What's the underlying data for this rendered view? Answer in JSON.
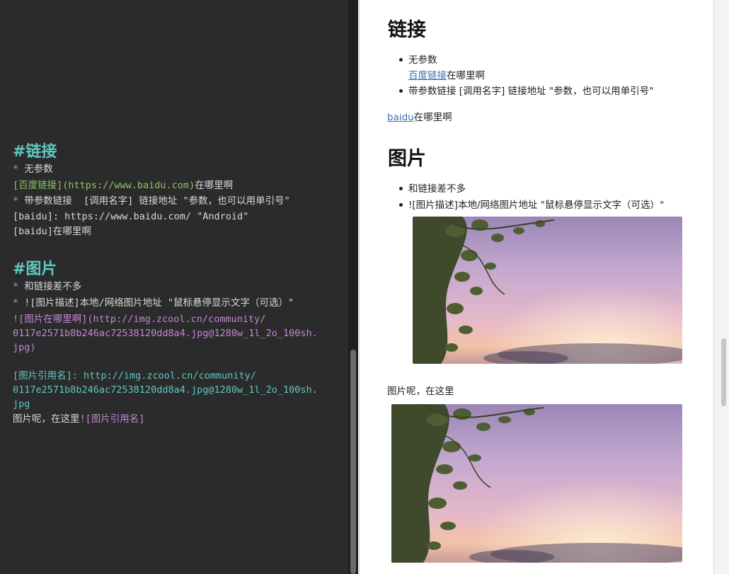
{
  "editor": {
    "link_heading": "#链接",
    "bullet_symbol": "*",
    "link_item1": "无参数",
    "link_item1_text": "[百度链接](https://www.baidu.com)",
    "link_item1_suffix": "在哪里啊",
    "link_item2": "带参数链接  [调用名字] 链接地址 \"参数，也可以用单引号\"",
    "ref_def": "[baidu]: https://www.baidu.com/ \"Android\"",
    "ref_use": "[baidu]在哪里啊",
    "image_heading": "#图片",
    "image_item1": "和链接差不多",
    "image_item2": "![图片描述]本地/网络图片地址 \"鼠标悬停显示文字（可选）\"",
    "image_inline_line1": "![图片在哪里啊](http://img.zcool.cn/community/",
    "image_inline_line2": "0117e2571b8b246ac72538120dd8a4.jpg@1280w_1l_2o_100sh.",
    "image_inline_line3": "jpg)",
    "image_ref_line1": "[图片引用名]: http://img.zcool.cn/community/",
    "image_ref_line2": "0117e2571b8b246ac72538120dd8a4.jpg@1280w_1l_2o_100sh.",
    "image_ref_line3": "jpg",
    "image_ref_use_prefix": "图片呢，在这里",
    "image_ref_use_ref": "![图片引用名]"
  },
  "preview": {
    "link_heading": "链接",
    "link_item1": "无参数",
    "link_item1_link": "百度链接",
    "link_item1_suffix": "在哪里啊",
    "link_item2": "带参数链接 [调用名字] 链接地址 \"参数，也可以用单引号\"",
    "baidu_link": "baidu",
    "baidu_suffix": "在哪里啊",
    "image_heading": "图片",
    "image_item1": "和链接差不多",
    "image_item2": "![图片描述]本地/网络图片地址 \"鼠标悬停显示文字（可选）\"",
    "image_caption": "图片呢，在这里"
  },
  "colors": {
    "editor_bg": "#2b2b2b",
    "heading": "#5fc7c1",
    "bullet": "#7ba7d8",
    "link_green": "#8cc265",
    "image_purple": "#c585d7",
    "preview_link": "#3f70b8"
  }
}
